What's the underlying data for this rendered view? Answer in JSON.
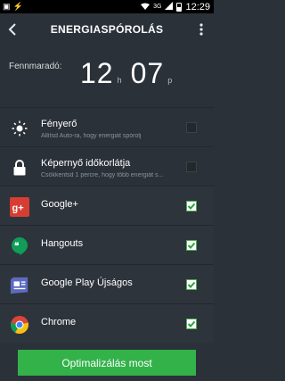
{
  "status_bar": {
    "network": "3G",
    "time": "12:29"
  },
  "header": {
    "title": "ENERGIASPÓROLÁS",
    "back_icon": "back-arrow-icon",
    "menu_icon": "more-vert-icon"
  },
  "remaining": {
    "label": "Fennmaradó:",
    "hours": "12",
    "hours_unit": "h",
    "minutes": "07",
    "minutes_unit": "p"
  },
  "items": [
    {
      "label": "Fényerő",
      "sub": "Állítsd Auto-ra, hogy energiát spórolj",
      "icon": "brightness-icon",
      "checked": false
    },
    {
      "label": "Képernyő időkorlátja",
      "sub": "Csökkentsd 1 percre, hogy több energiát s...",
      "icon": "lock-icon",
      "checked": false
    },
    {
      "label": "Google+",
      "sub": "",
      "icon": "google-plus-icon",
      "checked": true
    },
    {
      "label": "Hangouts",
      "sub": "",
      "icon": "hangouts-icon",
      "checked": true
    },
    {
      "label": "Google Play Újságos",
      "sub": "",
      "icon": "newsstand-icon",
      "checked": true
    },
    {
      "label": "Chrome",
      "sub": "",
      "icon": "chrome-icon",
      "checked": true
    }
  ],
  "cta": {
    "label": "Optimalizálás most"
  },
  "colors": {
    "background": "#2b3138",
    "accent_green": "#33b24a",
    "google_plus_red": "#d73d32",
    "hangouts_green": "#0f9d58",
    "newsstand_blue": "#5c6bc0"
  }
}
